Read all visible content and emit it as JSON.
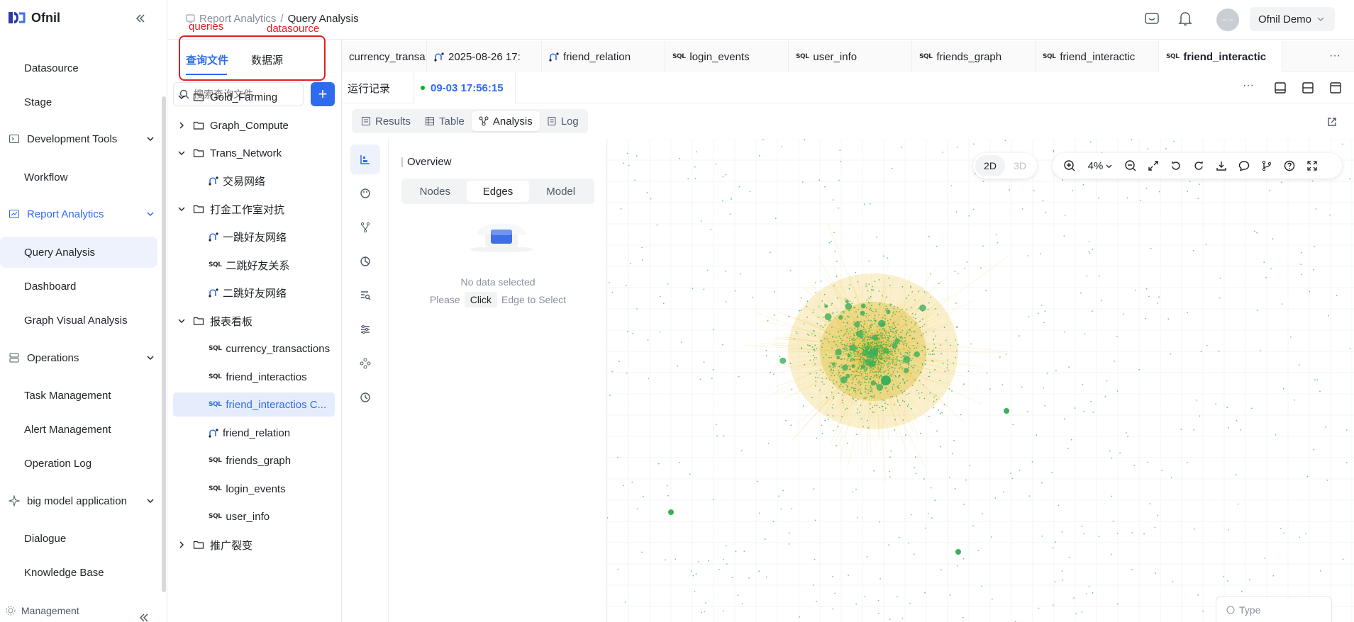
{
  "app": {
    "name": "Ofnil"
  },
  "sidebar": {
    "items": [
      {
        "label": "Datasource"
      },
      {
        "label": "Stage"
      },
      {
        "label": "Development Tools"
      },
      {
        "label": "Workflow"
      },
      {
        "label": "Report Analytics"
      },
      {
        "label": "Query Analysis"
      },
      {
        "label": "Dashboard"
      },
      {
        "label": "Graph Visual Analysis"
      },
      {
        "label": "Operations"
      },
      {
        "label": "Task Management"
      },
      {
        "label": "Alert Management"
      },
      {
        "label": "Operation Log"
      },
      {
        "label": "big model application"
      },
      {
        "label": "Dialogue"
      },
      {
        "label": "Knowledge Base"
      },
      {
        "label": "Management"
      }
    ]
  },
  "header": {
    "breadcrumb": [
      "Report Analytics",
      "/",
      "Query Analysis"
    ],
    "user": "Ofnil Demo",
    "avatar": "– –"
  },
  "annotations": {
    "queries": "queries",
    "datasource": "datasource"
  },
  "panel": {
    "tabs": [
      "查询文件",
      "数据源"
    ],
    "search_placeholder": "搜索查询文件",
    "add": "+",
    "tree": [
      {
        "label": "Gold_Farming"
      },
      {
        "label": "Graph_Compute"
      },
      {
        "label": "Trans_Network"
      },
      {
        "label": "交易网络"
      },
      {
        "label": "打金工作室对抗"
      },
      {
        "label": "一跳好友网络"
      },
      {
        "label": "二跳好友关系"
      },
      {
        "label": "二跳好友网络"
      },
      {
        "label": "报表看板"
      },
      {
        "label": "currency_transactions"
      },
      {
        "label": "friend_interactios"
      },
      {
        "label": "friend_interactios C..."
      },
      {
        "label": "friend_relation"
      },
      {
        "label": "friends_graph"
      },
      {
        "label": "login_events"
      },
      {
        "label": "user_info"
      },
      {
        "label": "推广裂变"
      }
    ],
    "sql_badge": "SQL"
  },
  "filetabs": [
    "currency_transa",
    "2025-08-26 17:",
    "friend_relation",
    "login_events",
    "user_info",
    "friends_graph",
    "friend_interactic",
    "friend_interactic"
  ],
  "more": "···",
  "runbar": {
    "label": "运行记录",
    "time": "09-03 17:56:15"
  },
  "result_tabs": [
    "Results",
    "Table",
    "Analysis",
    "Log"
  ],
  "overview": {
    "title": "Overview",
    "segments": [
      "Nodes",
      "Edges",
      "Model"
    ],
    "empty": "No data selected",
    "hint": [
      "Please",
      "Click",
      "Edge to Select"
    ]
  },
  "graph": {
    "dims": [
      "2D",
      "3D"
    ],
    "zoom": "4%",
    "type_placeholder": "Type",
    "node_color": "#3dae5a",
    "edge_color": "#f2c94c",
    "accent": "#2f6bef"
  }
}
